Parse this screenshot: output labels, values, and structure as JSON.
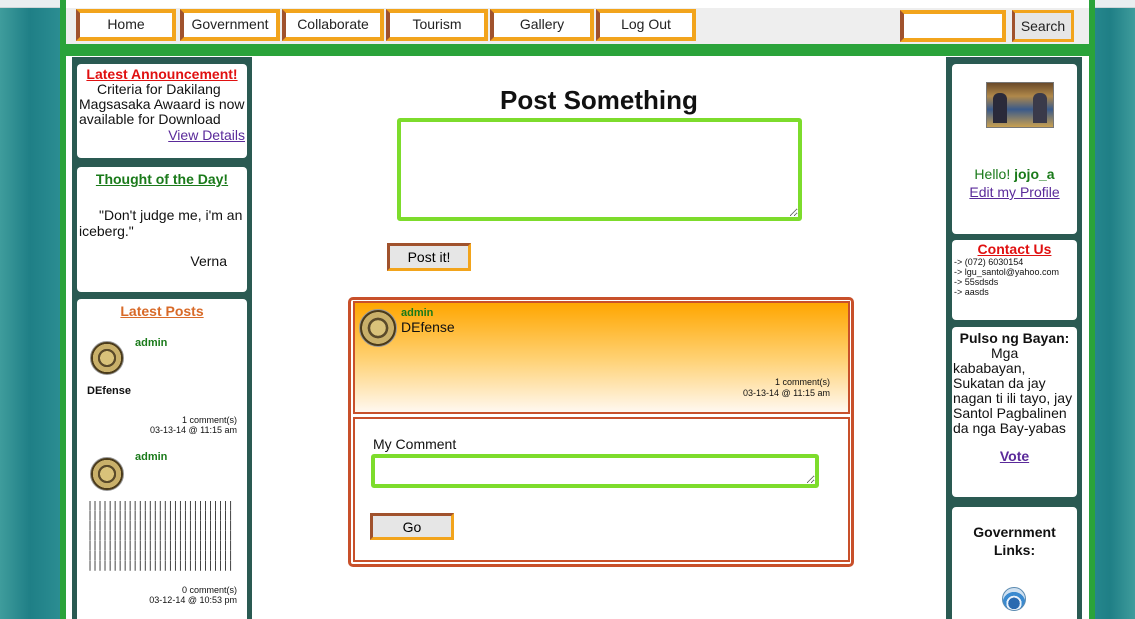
{
  "nav": {
    "items": [
      "Home",
      "Government",
      "Collaborate",
      "Tourism",
      "Gallery",
      "Log Out"
    ],
    "search_label": "Search",
    "search_value": ""
  },
  "left": {
    "announcement": {
      "title": "Latest Announcement!",
      "body": "Criteria for Dakilang Magsasaka Awaard is now available for Download",
      "link": "View Details"
    },
    "thought": {
      "title": "Thought of the Day!",
      "quote": "\"Don't judge me, i'm an iceberg.\"",
      "author": "Verna"
    },
    "latest_posts": {
      "title": "Latest Posts",
      "posts": [
        {
          "user": "admin",
          "text": "DEfense",
          "comments": "1 comment(s)",
          "date": "03-13-14 @ 11:15 am"
        },
        {
          "user": "admin",
          "text": "||||||||||||||||||||||||||||||||||||||||||||||||||||||||||||||||||||||||||||||||||||||||||||||||||||||||||||||||||||||||||||||||||||||||||||||||||||||||||||||||||||||||||||||||||||||||||||||||||||||||||||||||||||||||||||||||||||||||||||||||||||||||||||||||||||||||||||||||||||||||||||||||||||||||||||||||||||||||||||||",
          "comments": "0 comment(s)",
          "date": "03-12-14 @ 10:53 pm"
        }
      ]
    }
  },
  "main": {
    "title": "Post Something",
    "post_placeholder": "",
    "post_button": "Post it!",
    "feed": {
      "user": "admin",
      "text": "DEfense",
      "comments": "1 comment(s)",
      "date": "03-13-14 @ 11:15 am",
      "comment_label": "My Comment",
      "go_button": "Go"
    }
  },
  "right": {
    "greeting_prefix": "Hello!",
    "username": "jojo_a",
    "edit_profile": "Edit my Profile",
    "contact": {
      "title": "Contact Us",
      "lines": [
        "-> (072) 6030154",
        "-> lgu_santol@yahoo.com",
        "-> 55sdsds",
        "-> aasds"
      ]
    },
    "pulso": {
      "title": "Pulso ng Bayan:",
      "body": "Mga kababayan, Sukatan da jay nagan ti ili tayo, jay Santol Pagbalinen da nga Bay-yabas",
      "vote": "Vote"
    },
    "gov_links": {
      "title": "Government Links:"
    }
  },
  "colors": {
    "green_frame": "#2aa33a",
    "orange_border": "#f2a41c",
    "dark_panel": "#2a5a52",
    "lime_input": "#7ddc2c",
    "red_title": "#e01010"
  }
}
